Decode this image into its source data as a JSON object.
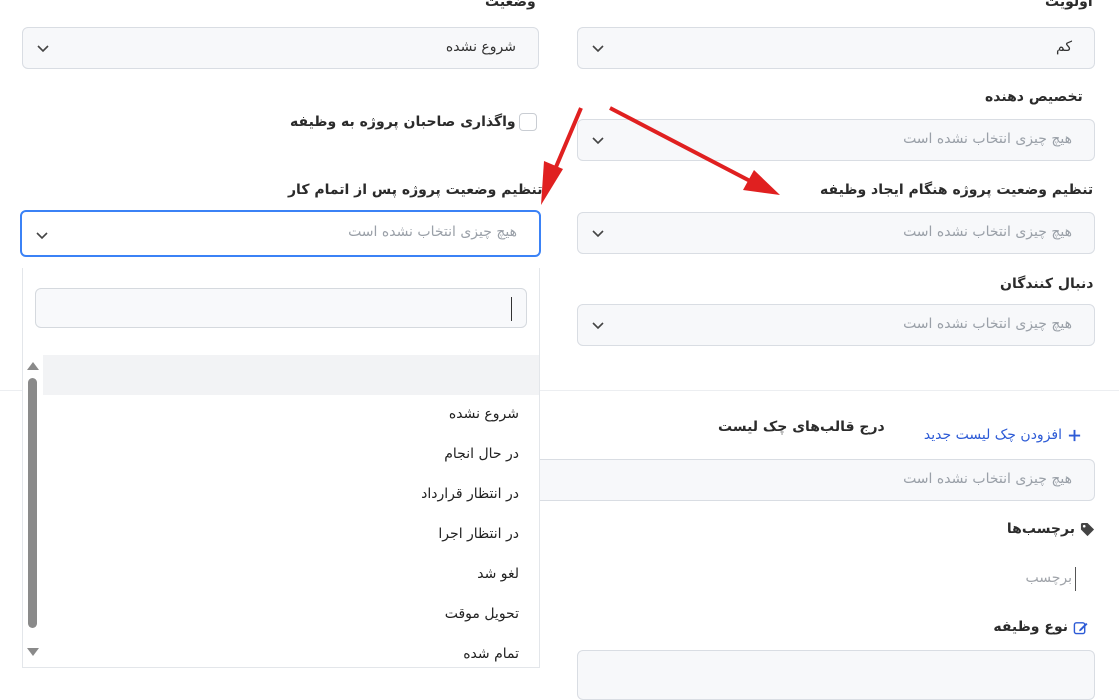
{
  "status": {
    "label": "وضعیت",
    "value": "شروع نشده"
  },
  "priority": {
    "label": "اولویت",
    "value": "کم"
  },
  "assigner": {
    "label": "تخصیص دهنده",
    "placeholder": "هیچ چیزی انتخاب نشده است"
  },
  "assign_owner_checkbox": {
    "label": "واگذاری صاحبان پروژه به وظیفه",
    "checked": false
  },
  "status_on_complete": {
    "label": "تنظیم وضعیت پروژه پس از اتمام کار",
    "placeholder": "هیچ چیزی انتخاب نشده است"
  },
  "status_on_create": {
    "label": "تنظیم وضعیت پروژه هنگام ایجاد وظیفه",
    "placeholder": "هیچ چیزی انتخاب نشده است"
  },
  "followers": {
    "label": "دنبال کنندگان",
    "placeholder": "هیچ چیزی انتخاب نشده است"
  },
  "dropdown": {
    "options": [
      "شروع نشده",
      "در حال انجام",
      "در انتظار قرارداد",
      "در انتظار اجرا",
      "لغو شد",
      "تحویل موقت",
      "تمام شده"
    ]
  },
  "checklist": {
    "label": "درج قالب‌های چک لیست",
    "add_link": "افزودن چک لیست جدید",
    "placeholder": "هیچ چیزی انتخاب نشده است"
  },
  "tags": {
    "label": "برچسب‌ها",
    "placeholder": "برچسب"
  },
  "task_type": {
    "label": "نوع وظیفه"
  },
  "colors": {
    "accent": "#3b82f6",
    "link": "#2d5bd6",
    "arrow": "#e02020"
  }
}
